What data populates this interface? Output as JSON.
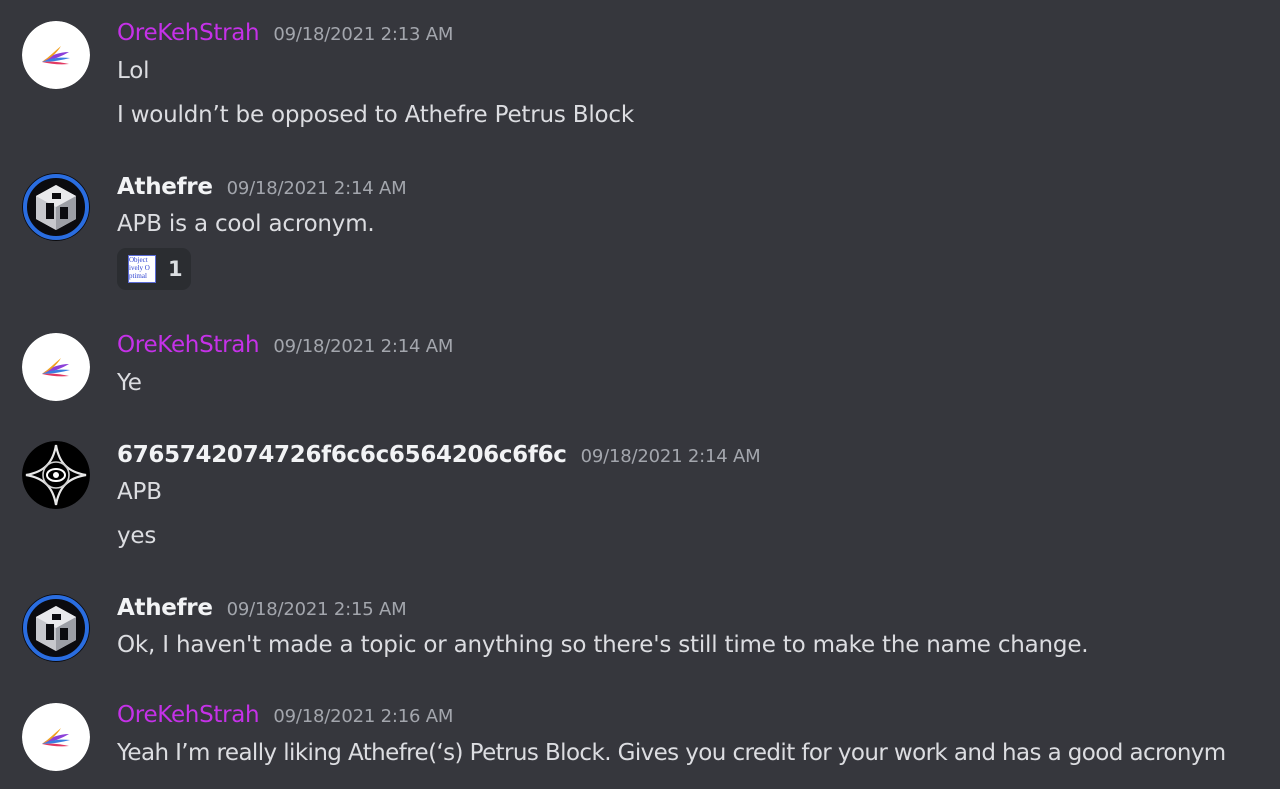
{
  "messages": [
    {
      "username": "OreKehStrah",
      "timestamp": "09/18/2021 2:13 AM",
      "lines": [
        "Lol",
        "I wouldn’t be opposed to Athefre Petrus Block"
      ]
    },
    {
      "username": "Athefre",
      "timestamp": "09/18/2021 2:14 AM",
      "lines": [
        "APB is a cool acronym."
      ],
      "reaction": {
        "emoji_text": "Objectively Optimal",
        "emoji_line1": "Object",
        "emoji_line2": "ively O",
        "emoji_line3": "ptimal",
        "count": "1"
      }
    },
    {
      "username": "OreKehStrah",
      "timestamp": "09/18/2021 2:14 AM",
      "lines": [
        "Ye"
      ]
    },
    {
      "username": "6765742074726f6c6c6564206c6f6c",
      "timestamp": "09/18/2021 2:14 AM",
      "lines": [
        "APB",
        "yes"
      ]
    },
    {
      "username": "Athefre",
      "timestamp": "09/18/2021 2:15 AM",
      "lines": [
        "Ok, I haven't made a topic or anything so there's still time to make the name change."
      ]
    },
    {
      "username": "OreKehStrah",
      "timestamp": "09/18/2021 2:16 AM",
      "lines": [
        "Yeah I’m really liking Athefre(‘s) Petrus Block. Gives you credit for your work and has a good acronym"
      ]
    }
  ],
  "colors": {
    "background": "#36373d",
    "username_purple": "#c531e8",
    "username_white": "#f2f3f5",
    "timestamp": "#a3a6ad",
    "message_text": "#dcdde1"
  },
  "icons": {
    "orekehstrah_avatar": "feather-logo-icon",
    "athefre_avatar": "cube-logo-icon",
    "hex_user_avatar": "star-eye-icon"
  }
}
